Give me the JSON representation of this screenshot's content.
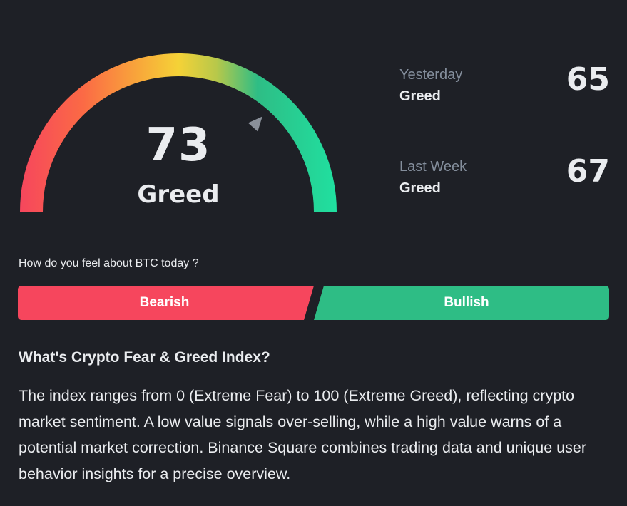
{
  "gauge": {
    "value": "73",
    "classification": "Greed",
    "colors": [
      "#f6465d",
      "#fc7d3a",
      "#f5d237",
      "#2ebd85",
      "#20e0a0"
    ]
  },
  "stats": {
    "yesterday": {
      "title": "Yesterday",
      "classification": "Greed",
      "value": "65"
    },
    "last_week": {
      "title": "Last Week",
      "classification": "Greed",
      "value": "67"
    }
  },
  "sentiment": {
    "question": "How do you feel about BTC today ?",
    "bearish_label": "Bearish",
    "bullish_label": "Bullish",
    "bearish_color": "#f6465d",
    "bullish_color": "#2ebd85"
  },
  "info": {
    "title": "What's Crypto Fear & Greed Index?",
    "body": "The index ranges from 0 (Extreme Fear) to 100 (Extreme Greed), reflecting crypto market sentiment. A low value signals over-selling, while a high value warns of a potential market correction. Binance Square combines trading data and unique user behavior insights for a precise overview."
  }
}
